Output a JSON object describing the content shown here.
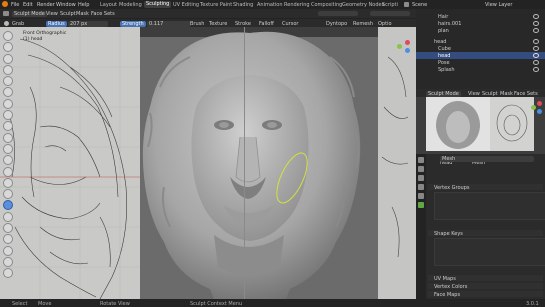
{
  "menu": {
    "items": [
      "File",
      "Edit",
      "Render",
      "Window",
      "Help"
    ],
    "workspaces": [
      "Layout",
      "Modeling",
      "Sculpting",
      "UV Editing",
      "Texture Paint",
      "Shading",
      "Animation",
      "Rendering",
      "Compositing",
      "Geometry Nodes",
      "Scripti"
    ],
    "active_workspace": "Sculpting",
    "scene_label": "Scene"
  },
  "header": {
    "mode": "Sculpt Mode",
    "menus": [
      "View",
      "Sculpt",
      "Mask",
      "Face Sets"
    ]
  },
  "tool_settings": {
    "brush_name": "Grab",
    "radius_label": "Radius",
    "radius_value": "207 px",
    "strength_label": "Strength",
    "strength_value": "0.117",
    "menus": [
      "Brush",
      "Texture",
      "Stroke",
      "Falloff",
      "Cursor"
    ],
    "dyntopo_label": "Dyntopo",
    "remesh_label": "Remesh",
    "options_label": "Optio"
  },
  "viewport": {
    "view_name": "Front Orthographic",
    "object_name": "(1) head"
  },
  "outliner": {
    "rows": [
      "Hair",
      "hairs.001",
      "plan",
      "head",
      "Cube",
      "head",
      "Pose",
      "Splash"
    ]
  },
  "right_header": {
    "view_layer": "View Layer",
    "mode": "Sculpt Mode",
    "menus": [
      "View",
      "Sculpt",
      "Mask",
      "Face Sets"
    ]
  },
  "properties": {
    "breadcrumb": [
      "head",
      "Mesh"
    ],
    "mesh_name": "Mesh",
    "sections": [
      "Vertex Groups",
      "Shape Keys",
      "UV Maps",
      "Vertex Colors",
      "Face Maps"
    ]
  },
  "status_bar": {
    "items": [
      "Select",
      "Move",
      "Rotate View",
      "Sculpt Context Menu"
    ],
    "version": "3.0.1"
  },
  "colors": {
    "accent": "#4772b3",
    "active_tool": "#5a8fd9",
    "mask_ellipse": "#d6e23a"
  }
}
